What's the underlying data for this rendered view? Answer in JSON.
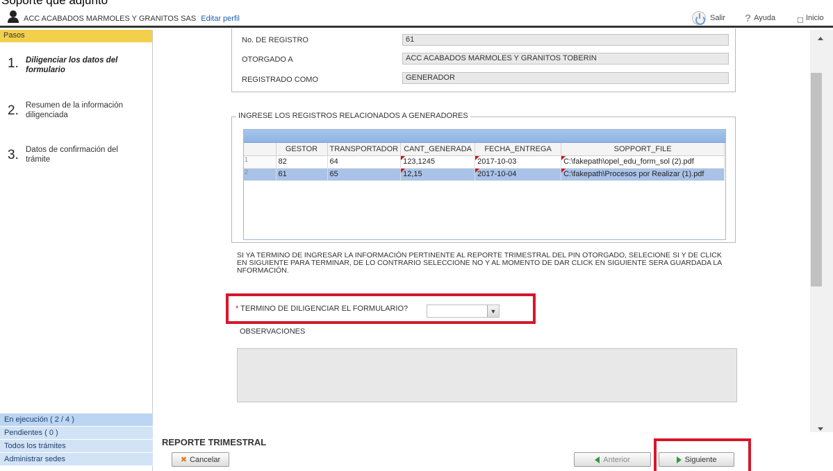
{
  "header": {
    "org_name": "ACC ACABADOS MARMOLES Y GRANITOS SAS",
    "edit_profile": "Editar perfil",
    "logout": "Salir",
    "help": "Ayuda",
    "home": "Inicio"
  },
  "sidebar": {
    "steps_title": "Pasos",
    "steps": [
      {
        "num": "1.",
        "label": "Diligenciar los datos del formulario"
      },
      {
        "num": "2.",
        "label": "Resumen de la información diligenciada"
      },
      {
        "num": "3.",
        "label": "Datos de confirmación del trámite"
      }
    ],
    "nav": [
      "En ejecución ( 2 / 4 )",
      "Pendientes ( 0 )",
      "Todos los trámites",
      "Administrar sedes"
    ]
  },
  "form": {
    "registro_label": "No. DE REGISTRO",
    "registro_value": "61",
    "otorgado_label": "OTORGADO A",
    "otorgado_value": "ACC ACABADOS MARMOLES Y GRANITOS TOBERIN",
    "registrado_label": "REGISTRADO COMO",
    "registrado_value": "GENERADOR",
    "grid_legend": "INGRESE LOS REGISTROS RELACIONADOS A GENERADORES",
    "grid": {
      "columns": [
        "GESTOR",
        "TRANSPORTADOR",
        "CANT_GENERADA",
        "FECHA_ENTREGA",
        "SOPPORT_FILE"
      ],
      "rows": [
        {
          "n": "1",
          "gestor": "82",
          "transportador": "64",
          "cant": "123,1245",
          "fecha": "2017-10-03",
          "file": "C:\\fakepath\\opel_edu_form_sol (2).pdf"
        },
        {
          "n": "2",
          "gestor": "61",
          "transportador": "65",
          "cant": "12,15",
          "fecha": "2017-10-04",
          "file": "C:\\fakepath\\Procesos por Realizar (1).pdf"
        }
      ]
    },
    "notice": "SI YA TERMINO DE INGRESAR LA INFORMACIÓN PERTINENTE AL REPORTE TRIMESTRAL DEL PIN OTORGADO, SELECIONE SI Y DE CLICK EN SIGUIENTE PARA TERMINAR, DE LO CONTRARIO SELECCIONE NO Y AL MOMENTO DE DAR CLICK EN SIGUIENTE SERA GUARDADA LA NFORMACIÓN.",
    "question_required": "*",
    "question": "TERMINO DE DILIGENCIAR EL FORMULARIO?",
    "question_value": "",
    "observaciones_label": "OBSERVACIONES",
    "observaciones_value": ""
  },
  "footer": {
    "section_title": "REPORTE TRIMESTRAL",
    "cancel": "Cancelar",
    "previous": "Anterior",
    "next": "Siguiente"
  },
  "colors": {
    "highlight_red": "#d4182b",
    "steps_bar": "#f3d04c",
    "nav_blue": "#bcd5f2",
    "selected_row": "#a9c3e8"
  }
}
